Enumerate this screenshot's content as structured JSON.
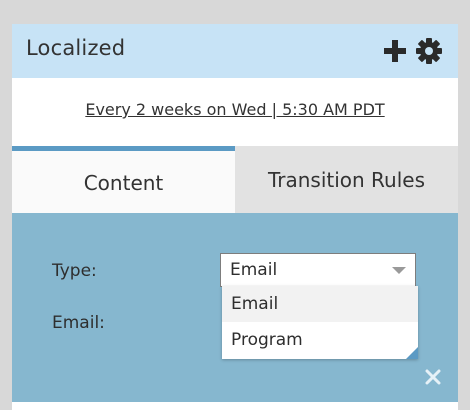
{
  "header": {
    "title": "Localized",
    "icons": [
      "plus-icon",
      "gear-icon"
    ]
  },
  "schedule": {
    "text": "Every 2 weeks on Wed  |  5:30 AM PDT"
  },
  "tabs": [
    {
      "label": "Content",
      "active": true
    },
    {
      "label": "Transition Rules",
      "active": false
    }
  ],
  "form": {
    "type_label": "Type:",
    "email_label": "Email:",
    "type_select": {
      "selected": "Email",
      "options": [
        "Email",
        "Program"
      ]
    }
  },
  "colors": {
    "header_bg": "#c7e3f6",
    "tab_accent": "#5b9ac4",
    "content_bg": "#86b7cf"
  }
}
